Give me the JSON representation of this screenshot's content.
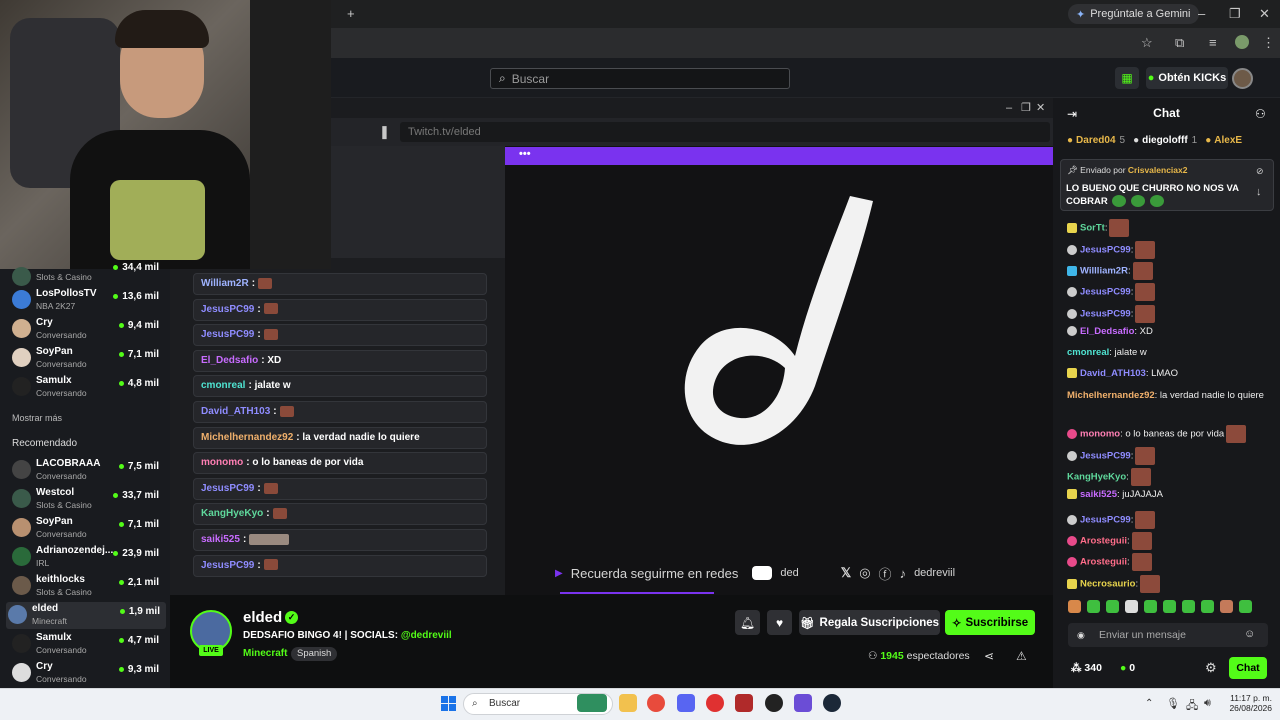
{
  "browser": {
    "gemini_label": "Pregúntale a Gemini"
  },
  "kick_header": {
    "search_placeholder": "Buscar",
    "get_kicks_label": "Obtén KICKs"
  },
  "sidebar": {
    "items_top": [
      {
        "name": "LosPollosTV",
        "category": "NBA 2K27",
        "viewers": "13,6 mil"
      },
      {
        "name": "Cry",
        "category": "Conversando",
        "viewers": "9,4 mil"
      },
      {
        "name": "SoyPan",
        "category": "Conversando",
        "viewers": "7,1 mil"
      },
      {
        "name": "Samulx",
        "category": "Conversando",
        "viewers": "4,8 mil"
      }
    ],
    "partial_top": {
      "category": "Slots & Casino",
      "viewers": "34,4 mil"
    },
    "show_more": "Mostrar más",
    "recommended_title": "Recomendado",
    "recommended": [
      {
        "name": "LACOBRAAA",
        "category": "Conversando",
        "viewers": "7,5 mil"
      },
      {
        "name": "Westcol",
        "category": "Slots & Casino",
        "viewers": "33,7 mil"
      },
      {
        "name": "SoyPan",
        "category": "Conversando",
        "viewers": "7,1 mil"
      },
      {
        "name": "Adrianozendej...",
        "category": "IRL",
        "viewers": "23,9 mil"
      },
      {
        "name": "keithlocks",
        "category": "Slots & Casino",
        "viewers": "2,1 mil"
      },
      {
        "name": "elded",
        "category": "Minecraft",
        "viewers": "1,9 mil"
      },
      {
        "name": "Samulx",
        "category": "Conversando",
        "viewers": "4,7 mil"
      },
      {
        "name": "Cry",
        "category": "Conversando",
        "viewers": "9,3 mil"
      }
    ]
  },
  "embedded": {
    "url": "Twitch.tv/elded",
    "dots": "•••",
    "chat_rows": [
      {
        "user": "William2R",
        "text": ":",
        "color": "#9fb3ff"
      },
      {
        "user": "JesusPC99",
        "text": ":",
        "color": "#8f8cff"
      },
      {
        "user": "JesusPC99",
        "text": ":",
        "color": "#8f8cff"
      },
      {
        "user": "El_Dedsafio",
        "text": ": XD",
        "color": "#c86cff"
      },
      {
        "user": "cmonreal",
        "text": ": jalate w",
        "color": "#4fe3d1"
      },
      {
        "user": "David_ATH103",
        "text": ":",
        "color": "#8f8cff"
      },
      {
        "user": "Michelhernandez92",
        "text": ": la verdad nadie lo quiere",
        "color": "#f0b06c"
      },
      {
        "user": "monomo",
        "text": ": o lo baneas de por vida",
        "color": "#ff7fb4"
      },
      {
        "user": "JesusPC99",
        "text": ":",
        "color": "#8f8cff"
      },
      {
        "user": "KangHyeKyo",
        "text": ":",
        "color": "#5fd89c"
      },
      {
        "user": "saiki525",
        "text": ":",
        "color": "#c86cff"
      },
      {
        "user": "JesusPC99",
        "text": ":",
        "color": "#8f8cff"
      }
    ],
    "video_bottom": {
      "text": "Recuerda seguirme en redes",
      "youtube_handle": "ded",
      "social_handle": "dedreviil"
    }
  },
  "channel": {
    "name": "elded",
    "live": "LIVE",
    "title": "DEDSAFIO BINGO 4! | SOCIALS:",
    "social": "@dedreviil",
    "category": "Minecraft",
    "language": "Spanish",
    "gift_label": "Regala Suscripciones",
    "subscribe_label": "Suscribirse",
    "viewers_count": "1945",
    "viewers_label": "espectadores"
  },
  "chat": {
    "title": "Chat",
    "leaders": [
      {
        "name": "Dared04",
        "count": "5"
      },
      {
        "name": "diegolofff",
        "count": "1"
      },
      {
        "name": "AlexE",
        "count": ""
      }
    ],
    "pinned_prefix": "Enviado por",
    "pinned_user": "Crisvalenciax2",
    "pinned_message": "LO BUENO QUE CHURRO NO NOS VA COBRAR",
    "messages": [
      {
        "user": "SorTt",
        "text": ":",
        "color": "#5fd89c"
      },
      {
        "user": "JesusPC99",
        "text": ":",
        "color": "#8f8cff"
      },
      {
        "user": "Willliam2R",
        "text": ":",
        "color": "#9fb3ff"
      },
      {
        "user": "JesusPC99",
        "text": ":",
        "color": "#8f8cff"
      },
      {
        "user": "JesusPC99",
        "text": ":",
        "color": "#8f8cff"
      },
      {
        "user": "El_Dedsafio",
        "text": ": XD",
        "color": "#c86cff"
      },
      {
        "user": "cmonreal",
        "text": ": jalate w",
        "color": "#4fe3d1"
      },
      {
        "user": "David_ATH103",
        "text": ": LMAO",
        "color": "#8f8cff"
      },
      {
        "user": "Michelhernandez92",
        "text": ": la verdad nadie lo quiere",
        "color": "#f0b06c"
      },
      {
        "user": "monomo",
        "text": ": o lo baneas de por vida",
        "color": "#ff7fb4"
      },
      {
        "user": "JesusPC99",
        "text": ":",
        "color": "#8f8cff"
      },
      {
        "user": "KangHyeKyo",
        "text": ":",
        "color": "#5fd89c"
      },
      {
        "user": "saiki525",
        "text": ": juJAJAJA",
        "color": "#c86cff"
      },
      {
        "user": "JesusPC99",
        "text": ":",
        "color": "#8f8cff"
      },
      {
        "user": "Arosteguii",
        "text": ":",
        "color": "#ff6d8a"
      },
      {
        "user": "Arosteguii",
        "text": ":",
        "color": "#ff6d8a"
      },
      {
        "user": "Necrosaurio",
        "text": ":",
        "color": "#e8d44d"
      }
    ],
    "input_placeholder": "Enviar un mensaje",
    "points": "340",
    "kick_points": "0",
    "send_label": "Chat"
  },
  "taskbar": {
    "search_placeholder": "Buscar",
    "time": "11:17 p. m.",
    "date": "26/08/2026"
  },
  "colors": {
    "kick_green": "#53fc18",
    "purple_bar": "#7a33ef"
  }
}
